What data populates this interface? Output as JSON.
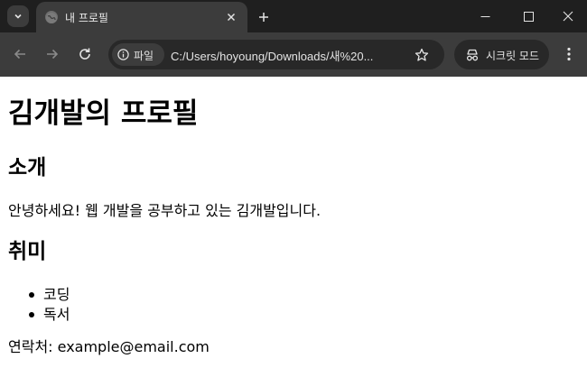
{
  "browser": {
    "tab": {
      "title": "내 프로필"
    },
    "omnibox": {
      "site_label": "파일",
      "url": "C:/Users/hoyoung/Downloads/새%20..."
    },
    "incognito_label": "시크릿 모드",
    "icons": {
      "tab_search": "chevron-down-icon",
      "favicon": "globe-icon",
      "tab_close": "close-icon",
      "new_tab": "plus-icon",
      "minimize": "minimize-icon",
      "maximize": "maximize-icon",
      "window_close": "close-icon",
      "back": "arrow-left-icon",
      "forward": "arrow-right-icon",
      "reload": "reload-icon",
      "site_info": "info-icon",
      "bookmark": "star-icon",
      "incognito": "incognito-icon",
      "menu": "kebab-menu-icon"
    },
    "colors": {
      "tabstrip_bg": "#1f1f1f",
      "toolbar_bg": "#3c3c3c",
      "omnibox_bg": "#282828",
      "text": "#e3e3e3"
    }
  },
  "page": {
    "title": "김개발의 프로필",
    "intro": {
      "heading": "소개",
      "text": "안녕하세요! 웹 개발을 공부하고 있는 김개발입니다."
    },
    "hobbies": {
      "heading": "취미",
      "items": [
        "코딩",
        "독서"
      ]
    },
    "contact": "연락처: example@email.com"
  }
}
